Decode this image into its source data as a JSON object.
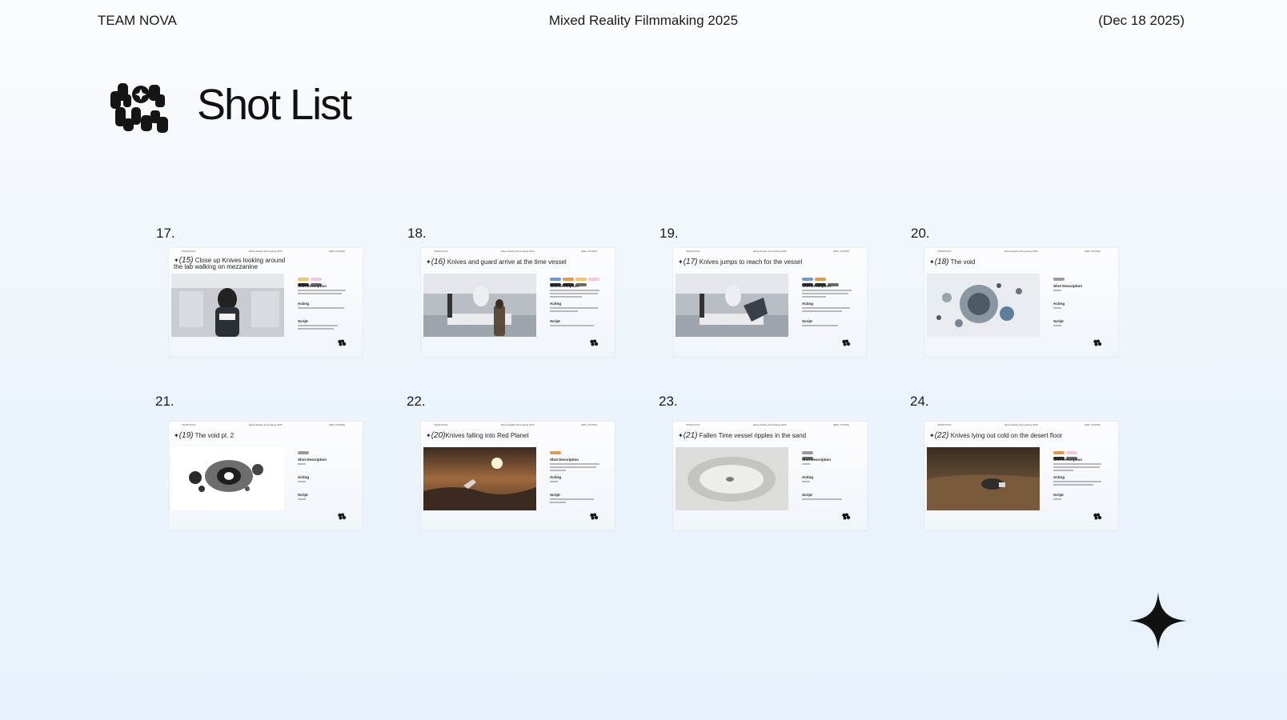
{
  "header": {
    "team": "TEAM NOVA",
    "project": "Mixed Reality Filmmaking 2025",
    "date": "(Dec 18 2025)"
  },
  "page_title": "Shot List",
  "icons": {
    "logo": "team-nova-logo-icon",
    "star": "four-point-star-icon"
  },
  "slide_header": {
    "left": "TEAM NOVA",
    "center": "Mixed Reality Filmmaking 2025",
    "right": "(DEC 18 2025)"
  },
  "section_labels": {
    "shot_description": "Shot Description",
    "acting": "Acting",
    "script": "Script"
  },
  "shots": [
    {
      "number": "17.",
      "shot_id": "(15)",
      "title": "Close up Knives looking around the lab walking on mezzanine",
      "image": "Knives close-up in lab"
    },
    {
      "number": "18.",
      "shot_id": "(16)",
      "title": "Knives and guard arrive at the time vessel",
      "image": "Knives and guard in lab"
    },
    {
      "number": "19.",
      "shot_id": "(17)",
      "title": "Knives jumps to reach for the vessel",
      "image": "Knives jumping in lab"
    },
    {
      "number": "20.",
      "shot_id": "(18)",
      "title": "The void",
      "image": "Vessel breaking apart in void"
    },
    {
      "number": "21.",
      "shot_id": "(19)",
      "title": "The void pt. 2",
      "image": "Dark vortex on white"
    },
    {
      "number": "22.",
      "shot_id": "(20)",
      "title": "Knives falling into Red Planet",
      "image": "Falling toward red planet"
    },
    {
      "number": "23.",
      "shot_id": "(21)",
      "title": "Fallen Time vessel ripples in the sand",
      "image": "Vessel crater in sand"
    },
    {
      "number": "24.",
      "shot_id": "(22)",
      "title": "Knives lying out cold on the desert floor",
      "image": "Knives on desert floor"
    }
  ]
}
